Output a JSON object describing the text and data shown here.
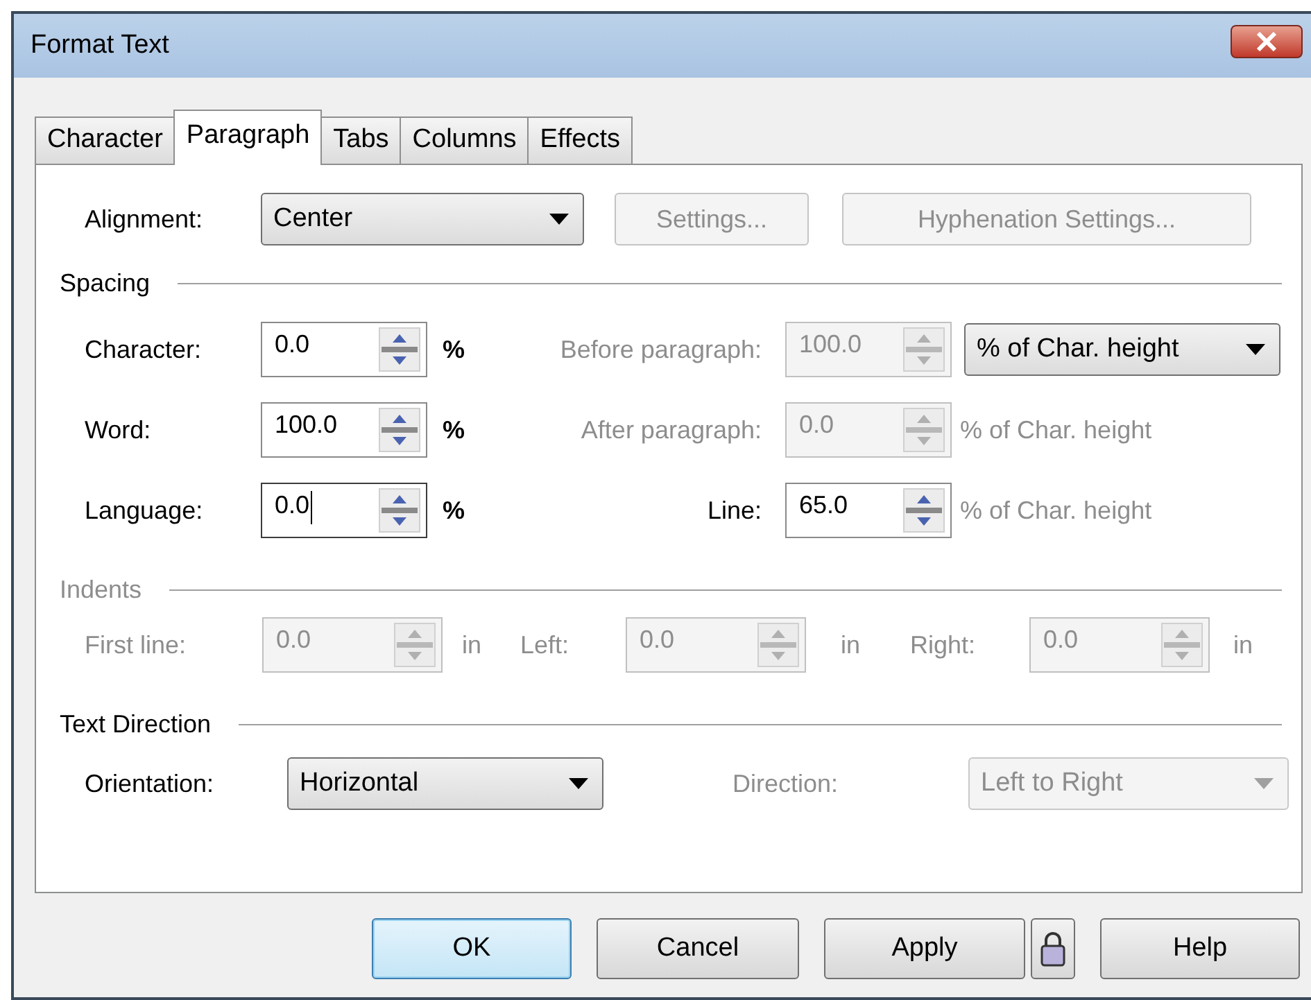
{
  "window": {
    "title": "Format Text"
  },
  "tabs": [
    {
      "label": "Character",
      "selected": false
    },
    {
      "label": "Paragraph",
      "selected": true
    },
    {
      "label": "Tabs",
      "selected": false
    },
    {
      "label": "Columns",
      "selected": false
    },
    {
      "label": "Effects",
      "selected": false
    }
  ],
  "alignment": {
    "label": "Alignment:",
    "value": "Center",
    "buttons": [
      {
        "label": "Settings...",
        "disabled": true
      },
      {
        "label": "Hyphenation Settings...",
        "disabled": true
      }
    ]
  },
  "spacing": {
    "heading": "Spacing",
    "rows": [
      {
        "left": {
          "label": "Character:",
          "value": "0.0",
          "unit": "%",
          "disabled": false,
          "focused": false
        },
        "right": {
          "label": "Before paragraph:",
          "value": "100.0",
          "unit": "% of Char. height",
          "kind": "dropdown",
          "disabled": true
        }
      },
      {
        "left": {
          "label": "Word:",
          "value": "100.0",
          "unit": "%",
          "disabled": false,
          "focused": false
        },
        "right": {
          "label": "After paragraph:",
          "value": "0.0",
          "unit": "% of Char. height",
          "kind": "text",
          "disabled": true
        }
      },
      {
        "left": {
          "label": "Language:",
          "value": "0.0",
          "unit": "%",
          "disabled": false,
          "focused": true
        },
        "right": {
          "label": "Line:",
          "value": "65.0",
          "unit": "% of Char. height",
          "kind": "text",
          "disabled": false
        }
      }
    ]
  },
  "indents": {
    "heading": "Indents",
    "disabled": true,
    "fields": [
      {
        "label": "First line:",
        "value": "0.0",
        "unit": "in"
      },
      {
        "label": "Left:",
        "value": "0.0",
        "unit": "in"
      },
      {
        "label": "Right:",
        "value": "0.0",
        "unit": "in"
      }
    ]
  },
  "text_direction": {
    "heading": "Text Direction",
    "orientation": {
      "label": "Orientation:",
      "value": "Horizontal",
      "disabled": false
    },
    "direction": {
      "label": "Direction:",
      "value": "Left to Right",
      "disabled": true
    }
  },
  "buttons": [
    {
      "kind": "text",
      "label": "OK",
      "default": true
    },
    {
      "kind": "text",
      "label": "Cancel",
      "default": false
    },
    {
      "kind": "text",
      "label": "Apply",
      "default": false
    },
    {
      "kind": "lock",
      "default": false
    },
    {
      "kind": "text",
      "label": "Help",
      "default": false
    }
  ]
}
